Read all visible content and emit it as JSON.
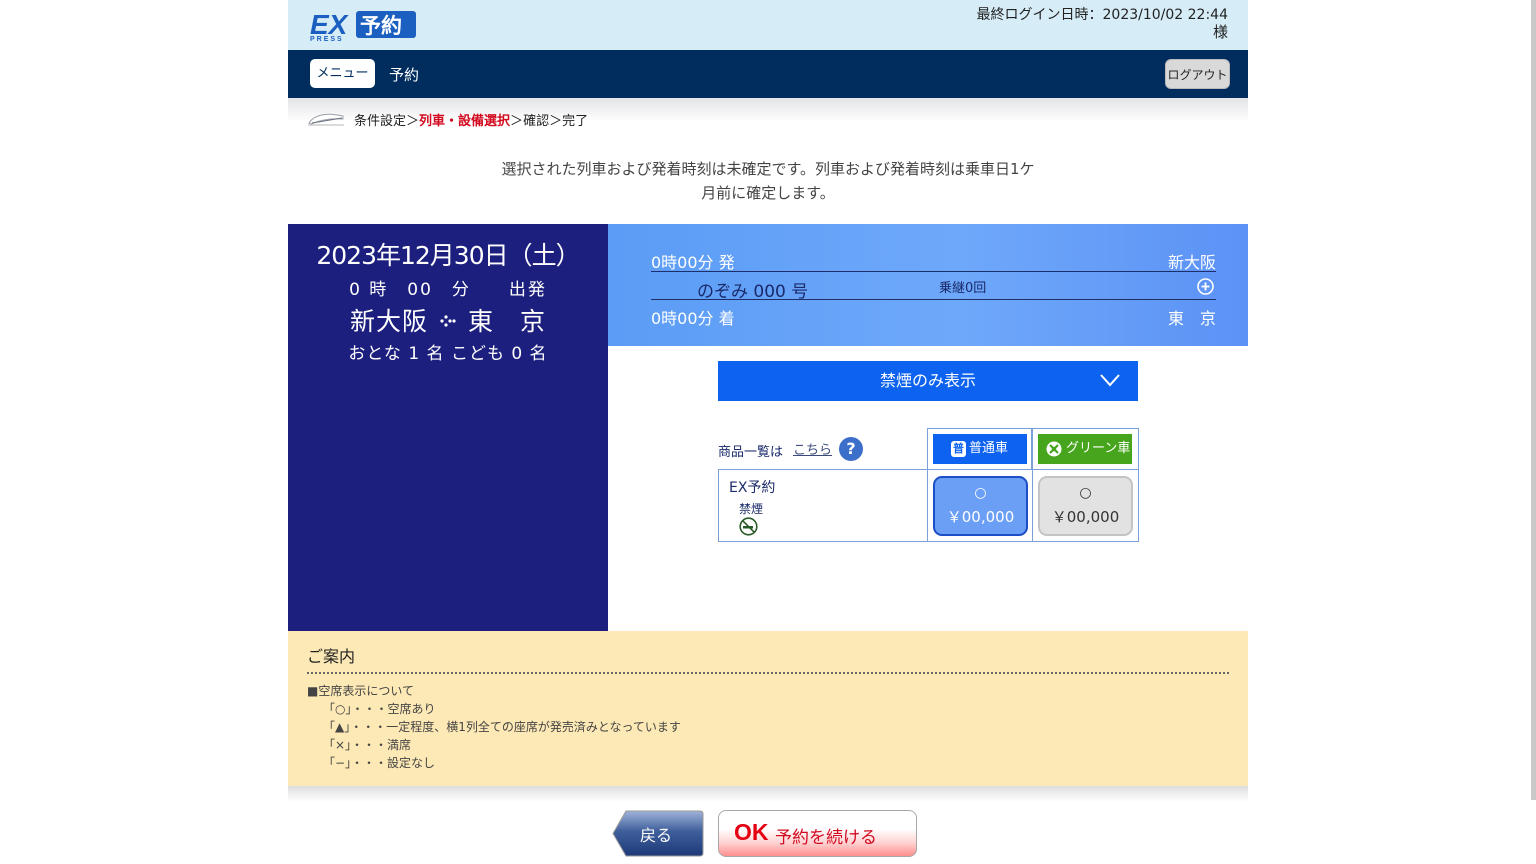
{
  "header": {
    "logo_text": "EX予約",
    "last_login": "最終ログイン日時：2023/10/02 22:44",
    "user_suffix": "様"
  },
  "nav": {
    "menu_label": "メニュー",
    "title": "予約",
    "logout_label": "ログアウト"
  },
  "breadcrumb": {
    "step1": "条件設定",
    "sep": "＞",
    "step2": "列車・設備選択",
    "step3": "確認",
    "step4": "完了"
  },
  "notice": {
    "line1": "選択された列車および発着時刻は未確定です。列車および発着時刻は乗車日1ケ",
    "line2": "月前に確定します。"
  },
  "trip": {
    "date": "2023年12月30日（土）",
    "time": "0 時　00　分　　出発",
    "from": "新大阪",
    "to": "東　京",
    "passengers": "おとな 1 名 こども 0 名"
  },
  "train": {
    "depart_time": "0時00分 発",
    "depart_station": "新大阪",
    "train_name": "のぞみ 000 号",
    "transfers": "乗継0回",
    "arrive_time": "0時00分 着",
    "arrive_station": "東　京"
  },
  "filter": {
    "label": "禁煙のみ表示"
  },
  "seat_table": {
    "product_list_label": "商品一覧は",
    "product_list_link": "こちら",
    "help": "?",
    "standard_label": "普通車",
    "standard_badge": "普",
    "green_label": "グリーン車",
    "product_name": "EX予約",
    "product_sub": "禁煙",
    "standard_mark": "○",
    "standard_price": "￥00,000",
    "green_mark": "○",
    "green_price": "￥00,000"
  },
  "guide": {
    "title": "ご案内",
    "heading": "■空席表示について",
    "items": [
      "「○」・・・空席あり",
      "「▲」・・・一定程度、横1列全ての座席が発売済みとなっています",
      "「×」・・・満席",
      "「−」・・・設定なし"
    ]
  },
  "actions": {
    "back_label": "戻る",
    "ok_mark": "OK",
    "ok_label": "予約を続ける"
  },
  "colors": {
    "header_bg": "#d6ecf7",
    "nav_bg": "#002d5e",
    "left_panel_bg": "#1c1f7d",
    "train_info_bg": "#6ea8fa",
    "filter_bg": "#0d63ef",
    "green_class": "#47a51d",
    "guide_bg": "#fde9b5",
    "accent_red": "#d2091f"
  }
}
